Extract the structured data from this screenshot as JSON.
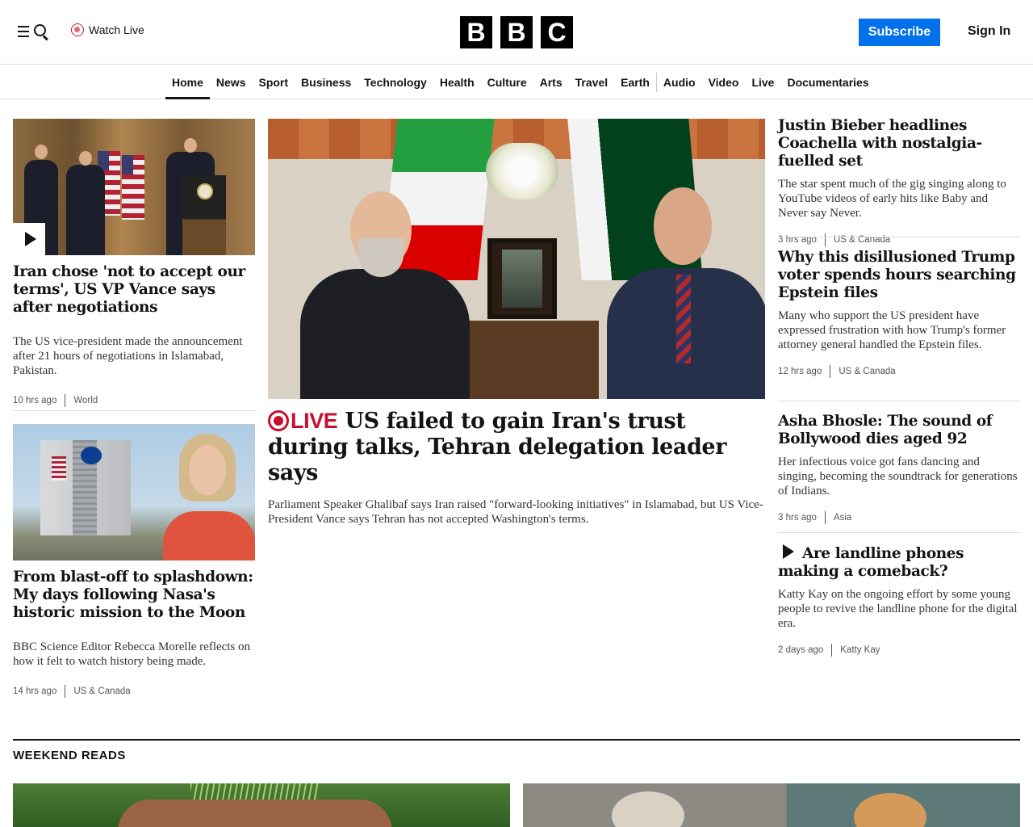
{
  "header": {
    "watch_live": "Watch Live",
    "logo_letters": [
      "B",
      "B",
      "C"
    ],
    "subscribe": "Subscribe",
    "sign_in": "Sign In"
  },
  "nav": {
    "items": [
      "Home",
      "News",
      "Sport",
      "Business",
      "Technology",
      "Health",
      "Culture",
      "Arts",
      "Travel",
      "Earth",
      "Audio",
      "Video",
      "Live",
      "Documentaries"
    ],
    "active": "Home"
  },
  "left_stories": [
    {
      "headline": "Iran chose 'not to accept our terms', US VP Vance says after negotiations",
      "summary": "The US vice-president made the announcement after 21 hours of negotiations in Islamabad, Pakistan.",
      "time": "10 hrs ago",
      "topic": "World"
    },
    {
      "headline": "From blast-off to splashdown: My days following Nasa's historic mission to the Moon",
      "summary": "BBC Science Editor Rebecca Morelle reflects on how it felt to watch history being made.",
      "time": "14 hrs ago",
      "topic": "US & Canada"
    }
  ],
  "main_story": {
    "live_label": "LIVE",
    "headline": "US failed to gain Iran's trust during talks, Tehran delegation leader says",
    "summary": "Parliament Speaker Ghalibaf says Iran raised \"forward-looking initiatives\" in Islamabad, but US Vice-President Vance says Tehran has not accepted Washington's terms."
  },
  "right_stories": [
    {
      "headline": "Justin Bieber headlines Coachella with nostalgia-fuelled set",
      "summary": "The star spent much of the gig singing along to YouTube videos of early hits like Baby and Never say Never.",
      "time": "3 hrs ago",
      "topic": "US & Canada"
    },
    {
      "headline": "Why this disillusioned Trump voter spends hours searching Epstein files",
      "summary": "Many who support the US president have expressed frustration with how Trump's former attorney general handled the Epstein files.",
      "time": "12 hrs ago",
      "topic": "US & Canada"
    },
    {
      "headline": "Asha Bhosle: The sound of Bollywood dies aged 92",
      "summary": "Her infectious voice got fans dancing and singing, becoming the soundtrack for generations of Indians.",
      "time": "3 hrs ago",
      "topic": "Asia"
    },
    {
      "headline": "Are landline phones making a comeback?",
      "summary": "Katty Kay on the ongoing effort by some young people to revive the landline phone for the digital era.",
      "time": "2 days ago",
      "topic": "Katty Kay"
    }
  ],
  "section": {
    "title": "WEEKEND READS"
  },
  "colors": {
    "subscribe_bg": "#0071ea",
    "live_red": "#c8102e",
    "text": "#141414"
  }
}
